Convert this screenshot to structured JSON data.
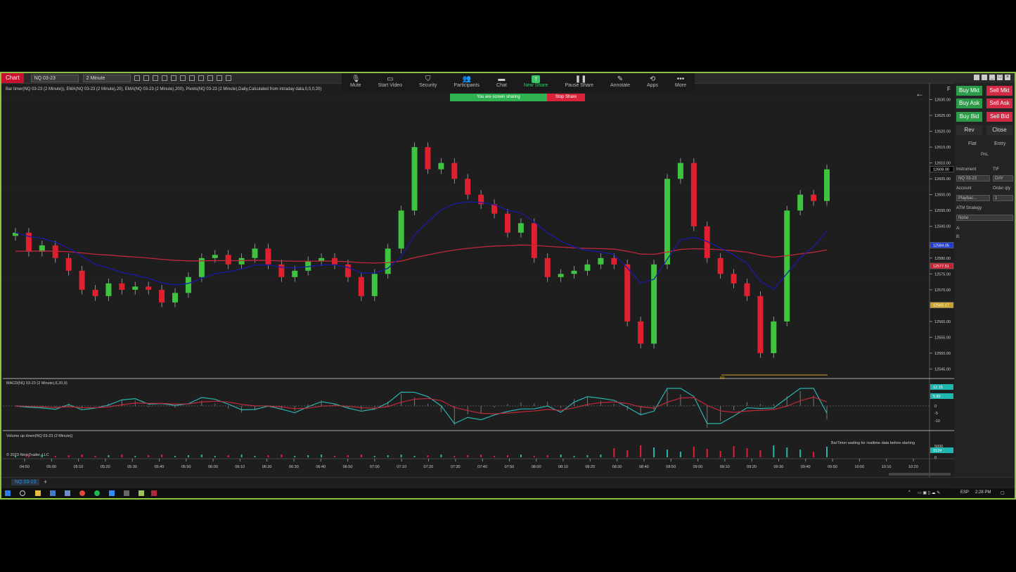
{
  "zoom": {
    "items": [
      {
        "label": "Mute",
        "icon": "microphone-icon"
      },
      {
        "label": "Start Video",
        "icon": "video-camera-icon"
      },
      {
        "label": "Security",
        "icon": "shield-icon"
      },
      {
        "label": "Participants",
        "icon": "participants-icon",
        "count": "1"
      },
      {
        "label": "Chat",
        "icon": "chat-icon"
      },
      {
        "label": "New Share",
        "icon": "share-screen-icon"
      },
      {
        "label": "Pause Share",
        "icon": "pause-icon"
      },
      {
        "label": "Annotate",
        "icon": "pen-icon"
      },
      {
        "label": "Apps",
        "icon": "apps-icon"
      },
      {
        "label": "More",
        "icon": "more-dots-icon"
      }
    ],
    "share_message": "You are screen sharing",
    "stop_share": "Stop Share"
  },
  "toolbar": {
    "chart_tab": "Chart",
    "instrument": "NQ 03-23",
    "interval": "2 Minute"
  },
  "chart": {
    "indicator_line": "Bar timer(NQ 03-23 (2 Minute)), EMA(NQ 03-23 (2 Minute),20), EMA(NQ 03-23 (2 Minute),200), Pivots(NQ 03-23 (2 Minute),Daily,Calculated from intraday data,0,0,0,20)",
    "f_label": "F",
    "bartimer_msg": "BarTimer waiting for realtime data before starting",
    "macd_label": "MACD(NQ 03-23 (2 Minute),6,20,9)",
    "volume_label": "Volume up down(NQ 03-23 (2 Minute))",
    "copyright": "© 2023 NinjaTrader, LLC",
    "pp_label": "PP",
    "price_ticks": [
      "12630.00",
      "12625.00",
      "12620.00",
      "12615.00",
      "12610.00",
      "12605.00",
      "12600.00",
      "12595.00",
      "12590.00",
      "12580.00",
      "12575.00",
      "12570.00",
      "12560.00",
      "12555.00",
      "12550.00",
      "12545.00"
    ],
    "price_badges": [
      {
        "text": "12608.00",
        "color": "#000000",
        "value": 12608
      },
      {
        "text": "12584.05",
        "color": "#1f3bd1",
        "value": 12584.05
      },
      {
        "text": "12577.51",
        "color": "#c81e32",
        "value": 12577.51
      },
      {
        "text": "12565.17",
        "color": "#c9a227",
        "value": 12565.17
      }
    ],
    "macd_ticks": [
      "0",
      "-5",
      "-10"
    ],
    "macd_badges": [
      {
        "text": "12.15",
        "color": "#1fb5b0"
      },
      {
        "text": "5.82",
        "color": "#1fb5b0"
      }
    ],
    "volume_ticks": [
      "5000",
      "0"
    ],
    "volume_badge": {
      "text": "3124",
      "color": "#1fb5b0"
    },
    "time_labels": [
      "04:50",
      "05:00",
      "05:10",
      "05:20",
      "05:30",
      "05:40",
      "05:50",
      "06:00",
      "06:10",
      "06:20",
      "06:30",
      "06:40",
      "06:50",
      "07:00",
      "07:10",
      "07:20",
      "07:30",
      "07:40",
      "07:50",
      "08:00",
      "08:10",
      "08:20",
      "08:30",
      "08:40",
      "08:50",
      "09:00",
      "09:10",
      "09:20",
      "09:30",
      "09:40",
      "09:50",
      "10:00",
      "10:10",
      "10:20"
    ],
    "colors": {
      "up": "#3ec43e",
      "down": "#e0202e",
      "ema20": "#1a1aa8",
      "ema200": "#c0283a",
      "macd": "#2ab3b0",
      "signal": "#c0283a"
    }
  },
  "chart_data": {
    "type": "candlestick",
    "series": [
      {
        "name": "EMA 20"
      },
      {
        "name": "EMA 200"
      }
    ],
    "ylim": [
      12542,
      12633
    ],
    "closes": [
      12588,
      12582,
      12584,
      12580,
      12576,
      12570,
      12568,
      12572,
      12570,
      12571,
      12570,
      12566,
      12569,
      12574,
      12580,
      12581,
      12578,
      12580,
      12583,
      12578,
      12574,
      12576,
      12579,
      12580,
      12578,
      12574,
      12568,
      12575,
      12583,
      12595,
      12615,
      12608,
      12610,
      12605,
      12600,
      12597,
      12594,
      12588,
      12591,
      12580,
      12574,
      12575,
      12576,
      12578,
      12580,
      12578,
      12560,
      12553,
      12578,
      12605,
      12610,
      12590,
      12580,
      12575,
      12572,
      12568,
      12550,
      12560,
      12595,
      12600,
      12598,
      12608
    ]
  },
  "panel": {
    "buy_mkt": "Buy Mkt",
    "sell_mkt": "Sell Mkt",
    "buy_ask": "Buy Ask",
    "sell_ask": "Sell Ask",
    "buy_bid": "Buy Bid",
    "sell_bid": "Sell Bid",
    "rev": "Rev",
    "close": "Close",
    "flat": "Flat",
    "entry": "Entry",
    "pnl": "PnL",
    "instrument_label": "Instrument",
    "tif_label": "TIF",
    "tif_value": "DAY",
    "instrument_value": "NQ 03-23",
    "account_label": "Account",
    "order_qty_label": "Order qty",
    "account_value": "Playbac...",
    "qty_value": "1",
    "atm_label": "ATM Strategy",
    "atm_value": "None",
    "a_label": "A:",
    "b_label": "B:"
  },
  "bottom": {
    "instrument_tab": "NQ 03-23",
    "add_tab": "+"
  },
  "taskbar": {
    "lang": "ESP",
    "time": "2:28 PM"
  }
}
